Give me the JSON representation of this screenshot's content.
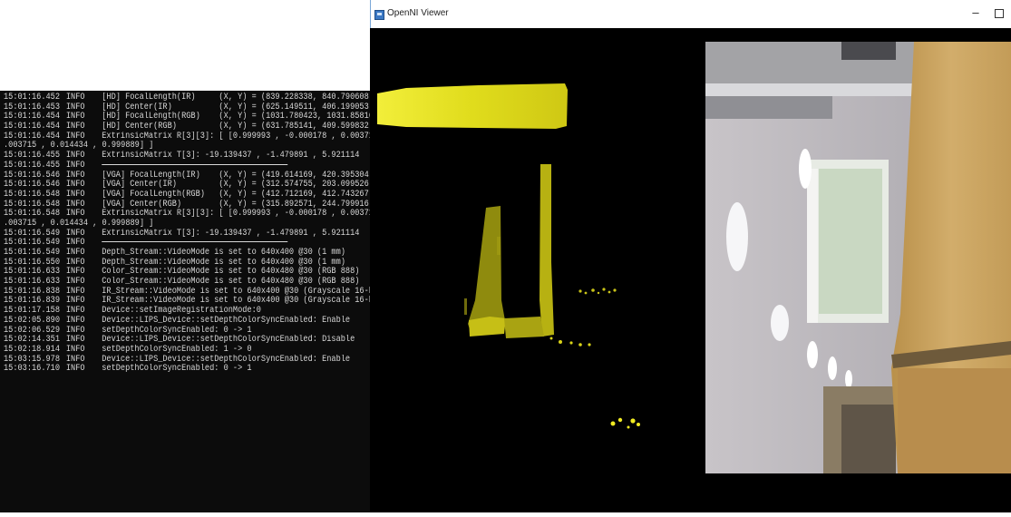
{
  "viewer": {
    "title": "OpenNI Viewer",
    "min_symbol": "–"
  },
  "console": {
    "lines": [
      {
        "ts": "15:01:16.452",
        "lvl": "INFO",
        "msg": "[HD] FocalLength(IR)     (X, Y) = (839.228338, 840.790608)"
      },
      {
        "ts": "15:01:16.453",
        "lvl": "INFO",
        "msg": "[HD] Center(IR)          (X, Y) = (625.149511, 406.199053)"
      },
      {
        "ts": "15:01:16.454",
        "lvl": "INFO",
        "msg": "[HD] FocalLength(RGB)    (X, Y) = (1031.780423, 1031.858168)"
      },
      {
        "ts": "15:01:16.454",
        "lvl": "INFO",
        "msg": "[HD] Center(RGB)         (X, Y) = (631.785141, 409.599832)"
      },
      {
        "ts": "15:01:16.454",
        "lvl": "INFO",
        "msg": "ExtrinsicMatrix R[3][3]: [ [0.999993 , -0.000178 , 0.003718] [0.0"
      },
      {
        "cont": true,
        "msg": ".003715 , 0.014434 , 0.999889] ]"
      },
      {
        "ts": "15:01:16.455",
        "lvl": "INFO",
        "msg": "ExtrinsicMatrix T[3]: -19.139437 , -1.479891 , 5.921114"
      },
      {
        "ts": "15:01:16.455",
        "lvl": "INFO",
        "sep": true,
        "msg": ""
      },
      {
        "ts": "15:01:16.546",
        "lvl": "INFO",
        "msg": "[VGA] FocalLength(IR)    (X, Y) = (419.614169, 420.395304)"
      },
      {
        "ts": "15:01:16.546",
        "lvl": "INFO",
        "msg": "[VGA] Center(IR)         (X, Y) = (312.574755, 203.099526)"
      },
      {
        "ts": "15:01:16.548",
        "lvl": "INFO",
        "msg": "[VGA] FocalLength(RGB)   (X, Y) = (412.712169, 412.743267)"
      },
      {
        "ts": "15:01:16.548",
        "lvl": "INFO",
        "msg": "[VGA] Center(RGB)        (X, Y) = (315.892571, 244.799916)"
      },
      {
        "ts": "15:01:16.548",
        "lvl": "INFO",
        "msg": "ExtrinsicMatrix R[3][3]: [ [0.999993 , -0.000178 , 0.003718] [0.0"
      },
      {
        "cont": true,
        "msg": ".003715 , 0.014434 , 0.999889] ]"
      },
      {
        "ts": "15:01:16.549",
        "lvl": "INFO",
        "msg": "ExtrinsicMatrix T[3]: -19.139437 , -1.479891 , 5.921114"
      },
      {
        "ts": "15:01:16.549",
        "lvl": "INFO",
        "sep": true,
        "msg": ""
      },
      {
        "ts": "15:01:16.549",
        "lvl": "INFO",
        "msg": "Depth_Stream::VideoMode is set to 640x400 @30 (1 mm)"
      },
      {
        "ts": "15:01:16.550",
        "lvl": "INFO",
        "msg": "Depth_Stream::VideoMode is set to 640x400 @30 (1 mm)"
      },
      {
        "ts": "15:01:16.633",
        "lvl": "INFO",
        "msg": "Color_Stream::VideoMode is set to 640x480 @30 (RGB 888)"
      },
      {
        "ts": "15:01:16.633",
        "lvl": "INFO",
        "msg": "Color_Stream::VideoMode is set to 640x480 @30 (RGB 888)"
      },
      {
        "ts": "15:01:16.838",
        "lvl": "INFO",
        "msg": "IR_Stream::VideoMode is set to 640x400 @30 (Grayscale 16-bit)"
      },
      {
        "ts": "15:01:16.839",
        "lvl": "INFO",
        "msg": "IR_Stream::VideoMode is set to 640x400 @30 (Grayscale 16-bit)"
      },
      {
        "ts": "15:01:17.158",
        "lvl": "INFO",
        "msg": "Device::setImageRegistrationMode:0"
      },
      {
        "ts": "15:02:05.890",
        "lvl": "INFO",
        "msg": "Device::LIPS_Device::setDepthColorSyncEnabled: Enable"
      },
      {
        "ts": "15:02:06.529",
        "lvl": "INFO",
        "msg": "setDepthColorSyncEnabled: 0 -> 1"
      },
      {
        "ts": "15:02:14.351",
        "lvl": "INFO",
        "msg": "Device::LIPS_Device::setDepthColorSyncEnabled: Disable"
      },
      {
        "ts": "15:02:18.914",
        "lvl": "INFO",
        "msg": "setDepthColorSyncEnabled: 1 -> 0"
      },
      {
        "ts": "15:03:15.978",
        "lvl": "INFO",
        "msg": "Device::LIPS_Device::setDepthColorSyncEnabled: Enable"
      },
      {
        "ts": "15:03:16.710",
        "lvl": "INFO",
        "msg": "setDepthColorSyncEnabled: 0 -> 1"
      }
    ]
  },
  "colors": {
    "console_bg": "#0c0c0c",
    "console_text": "#d8d8d8",
    "depth_yellow": "#e6e21a",
    "viewer_bg": "#000000"
  }
}
